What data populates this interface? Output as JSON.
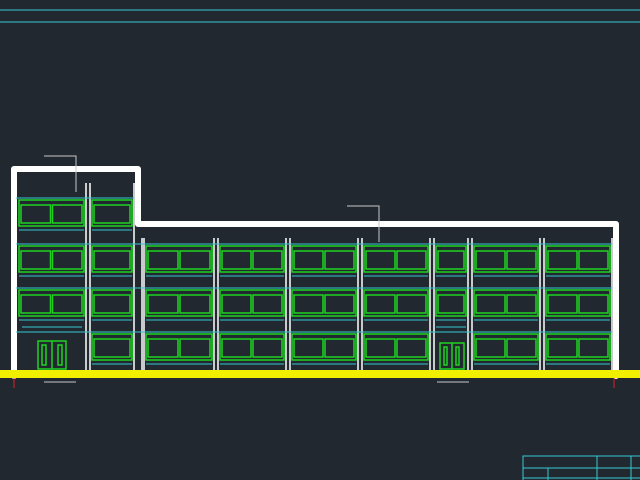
{
  "viewport": {
    "background": "#212830"
  },
  "colors": {
    "cyan": "#35c9d0",
    "white": "#ffffff",
    "green": "#1fd21f",
    "yellow": "#f0f000",
    "red": "#e02020",
    "thin": "#c8c8c8"
  },
  "drawing": {
    "top_border_icon": "frame-border-lines",
    "ground_line_icon": "ground-line",
    "roof_outline_icon": "roof-outline",
    "door_icon": "double-door",
    "window_icon": "window",
    "leader_icon": "leader-line",
    "title_block_icon": "title-block-grid"
  }
}
